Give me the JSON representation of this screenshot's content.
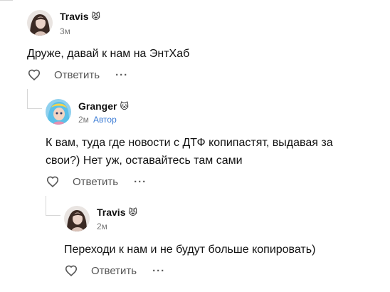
{
  "comments": [
    {
      "author": "Travis",
      "emoji": "😾",
      "time": "3м",
      "text": "Друже, давай к нам на ЭнтХаб",
      "reply_label": "Ответить",
      "more_label": "···"
    },
    {
      "author": "Granger",
      "emoji": "🐱",
      "time": "2м",
      "badge": "Автор",
      "text_lines": [
        "К вам, туда где новости с ДТФ копипастят, выдавая за",
        "свои?) Нет уж, оставайтесь там сами"
      ],
      "reply_label": "Ответить",
      "more_label": "···"
    },
    {
      "author": "Travis",
      "emoji": "😾",
      "time": "2м",
      "text": "Переходи к нам и не будут больше копировать)",
      "reply_label": "Ответить",
      "more_label": "···"
    }
  ],
  "colors": {
    "text": "#111111",
    "meta": "#777777",
    "author_badge": "#3a7bd5",
    "thread_line": "#d6d6d6"
  },
  "icons": {
    "like": "heart-icon",
    "more": "more-icon"
  }
}
